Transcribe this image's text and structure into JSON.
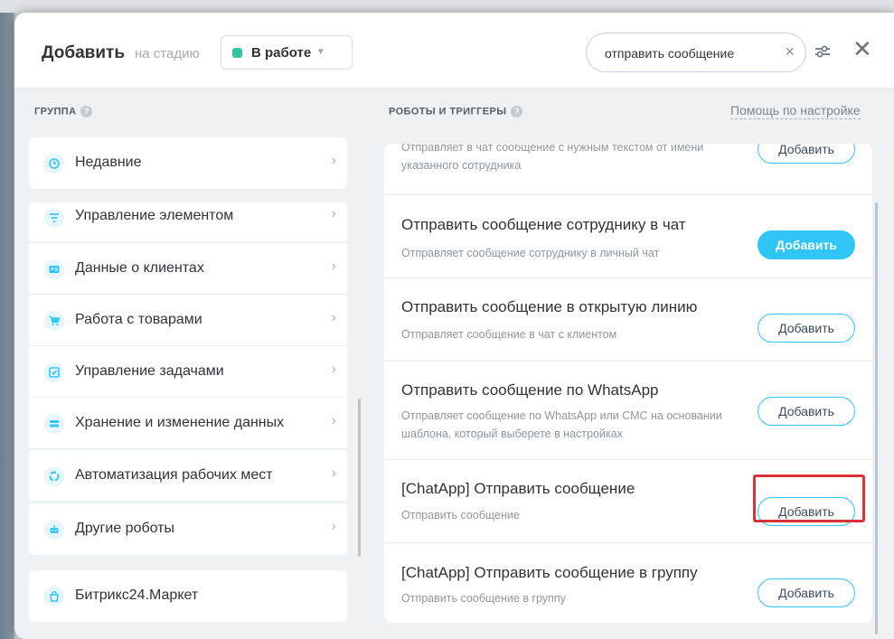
{
  "header": {
    "title": "Добавить",
    "stage_label": "на стадию",
    "stage_value": "В работе",
    "stage_color": "#2fc6a0",
    "search_value": "отправить сообщение"
  },
  "left": {
    "section_title": "ГРУППА",
    "groups": [
      {
        "label": "Недавние",
        "icon": "clock-icon"
      },
      {
        "label": "Управление элементом",
        "icon": "filter-icon"
      },
      {
        "label": "Данные о клиентах",
        "icon": "contact-card-icon"
      },
      {
        "label": "Работа с товарами",
        "icon": "cart-icon"
      },
      {
        "label": "Управление задачами",
        "icon": "task-icon"
      },
      {
        "label": "Хранение и изменение данных",
        "icon": "database-icon"
      },
      {
        "label": "Автоматизация рабочих мест",
        "icon": "cycle-icon"
      },
      {
        "label": "Другие роботы",
        "icon": "robot-icon"
      }
    ],
    "market": {
      "label": "Битрикс24.Маркет",
      "icon": "market-bag-icon"
    }
  },
  "right": {
    "section_title": "РОБОТЫ И ТРИГГЕРЫ",
    "help_link": "Помощь по настройке",
    "items": [
      {
        "title": "",
        "desc": "Отправляет в чат сообщение с нужным текстом от имени указанного сотрудника",
        "button": "Добавить"
      },
      {
        "title": "Отправить сообщение сотруднику в чат",
        "desc": "Отправляет сообщение сотруднику в личный чат",
        "button": "Добавить",
        "primary": true
      },
      {
        "title": "Отправить сообщение в открытую линию",
        "desc": "Отправляет сообщение в чат с клиентом",
        "button": "Добавить"
      },
      {
        "title": "Отправить сообщение по WhatsApp",
        "desc": "Отправляет сообщение по WhatsApp или СМС на основании шаблона, который выберете в настройках",
        "button": "Добавить"
      },
      {
        "title": "[ChatApp] Отправить сообщение",
        "desc": "Отправить сообщение",
        "button": "Добавить",
        "highlighted": true
      },
      {
        "title": "[ChatApp] Отправить сообщение в группу",
        "desc": "Отправить сообщение в группу",
        "button": "Добавить"
      }
    ]
  },
  "colors": {
    "accent": "#2fc6f6",
    "highlight": "#d9333a"
  }
}
